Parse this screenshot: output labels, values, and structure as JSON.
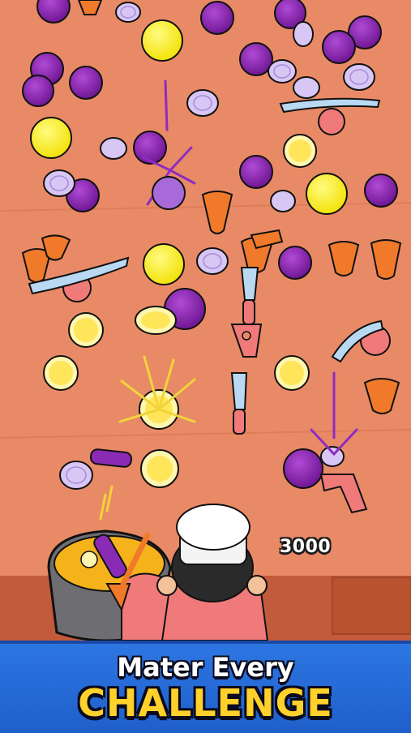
{
  "hud": {
    "score": "3000"
  },
  "banner": {
    "line1": "Mater Every",
    "line2": "CHALLENGE"
  },
  "colors": {
    "table": "#e98a67",
    "onion": "#7b1fa2",
    "onion_slice": "#d8c6f4",
    "lemon": "#fff12e",
    "lemon_slice": "#fff7b0",
    "carrot": "#f07a2a",
    "blade": "#b9d8f2",
    "blade_base": "#f07a7a",
    "banner": "#2366d8",
    "banner_text": "#ffffff",
    "banner_accent": "#ffd12a"
  }
}
